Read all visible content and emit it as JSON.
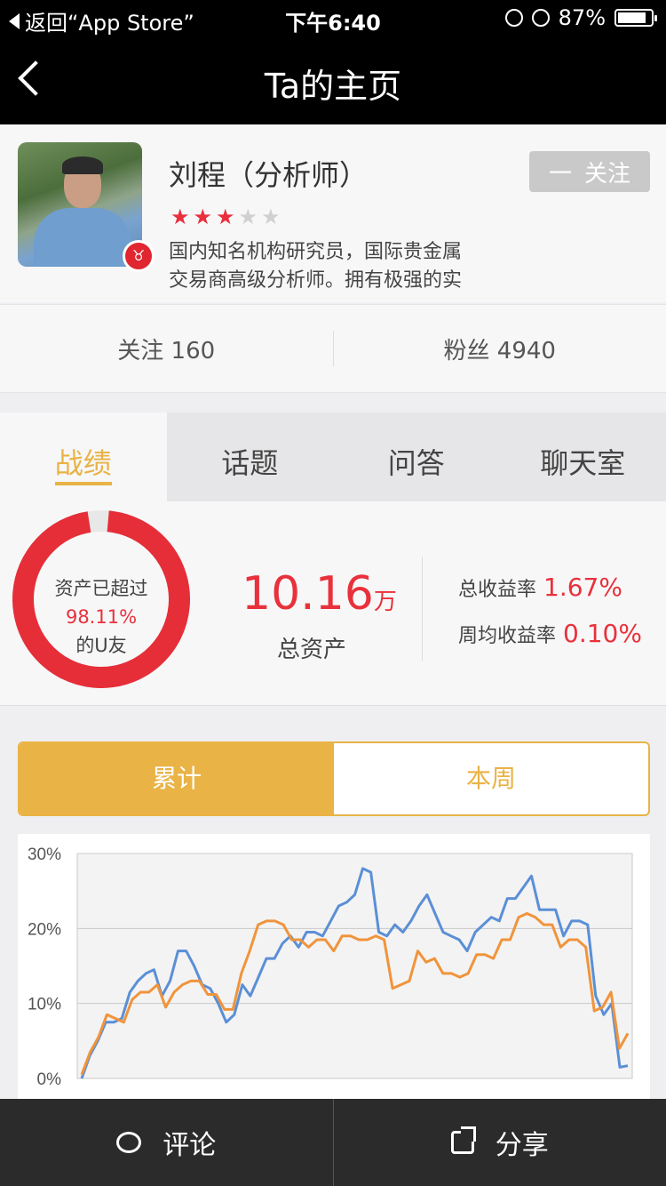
{
  "status_bar": {
    "back_app": "返回“App Store”",
    "time": "下午6:40",
    "battery": "87%",
    "battery_fraction": 0.87
  },
  "nav": {
    "title": "Ta的主页"
  },
  "profile": {
    "name": "刘程（分析师）",
    "rating": 3,
    "rating_max": 5,
    "bio_line1": "国内知名机构研究员，国际贵金属",
    "bio_line2": "交易商高级分析师。拥有极强的实",
    "follow_label": "关注",
    "follow_prefix": "一"
  },
  "counts": {
    "following": "关注 160",
    "fans": "粉丝 4940"
  },
  "tabs": [
    "战绩",
    "话题",
    "问答",
    "聊天室"
  ],
  "stats": {
    "ring_line1": "资产已超过",
    "ring_pct": "98.11%",
    "ring_line3": "的U友",
    "ring_fraction": 0.9811,
    "total_value": "10.16",
    "total_unit": "万",
    "total_label": "总资产",
    "rate1_label": "总收益率",
    "rate1_value": "1.67%",
    "rate2_label": "周均收益率",
    "rate2_value": "0.10%"
  },
  "segment": {
    "options": [
      "累计",
      "本周"
    ],
    "selected": 0
  },
  "chart_data": {
    "type": "line",
    "yticks": [
      "0%",
      "10%",
      "20%",
      "30%"
    ],
    "ylim": [
      0,
      30
    ],
    "series": [
      {
        "color": "#5b8fd6",
        "values": [
          0,
          3,
          5,
          7.5,
          7.5,
          8,
          11.5,
          13,
          14,
          14.5,
          11,
          13,
          17,
          17,
          15,
          12.5,
          12,
          10,
          7.5,
          8.5,
          12.5,
          11,
          13.5,
          16,
          16,
          18,
          19,
          17.5,
          19.5,
          19.5,
          19,
          21,
          23,
          23.5,
          24.5,
          28,
          27.5,
          19.5,
          19,
          20.5,
          19.5,
          21,
          23,
          24.5,
          22,
          19.5,
          19,
          18.5,
          17,
          19.5,
          20.5,
          21.5,
          21,
          24,
          24,
          25.5,
          27,
          22.5,
          22.5,
          22.5,
          19,
          21,
          21,
          20.5,
          11,
          8.5,
          10,
          1.5,
          1.7
        ]
      },
      {
        "color": "#f0943c",
        "values": [
          0.5,
          3.5,
          5.5,
          8.5,
          8,
          7.5,
          10.5,
          11.5,
          11.5,
          12.5,
          9.5,
          11.5,
          12.5,
          13,
          13,
          11.2,
          11.2,
          9.2,
          9.2,
          14,
          17,
          20.5,
          21,
          21,
          20.5,
          18.5,
          18.5,
          17.5,
          18.5,
          18.5,
          17,
          19,
          19,
          18.5,
          18.5,
          19,
          18.5,
          12,
          12.5,
          13,
          17,
          15.5,
          16,
          14,
          14,
          13.5,
          14,
          16.5,
          16.5,
          16,
          18.5,
          18.5,
          21.5,
          22,
          21.5,
          20.5,
          20.5,
          17.5,
          18.5,
          18.5,
          17.5,
          9,
          9.5,
          11.5,
          4,
          6
        ]
      }
    ]
  },
  "footer": {
    "comment": "评论",
    "share": "分享"
  }
}
